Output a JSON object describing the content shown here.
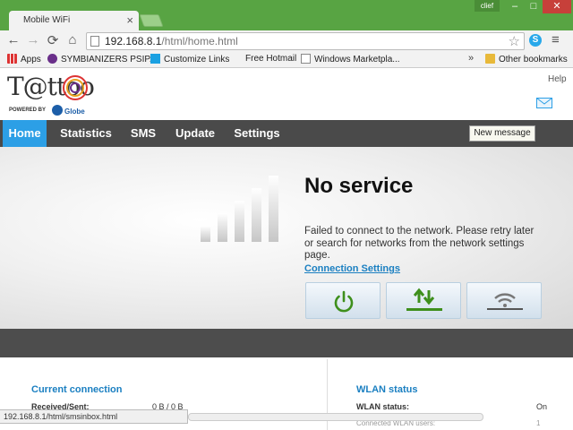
{
  "browser": {
    "tab_title": "Mobile WiFi",
    "tab_close": "×",
    "user_name": "clief",
    "window_controls": {
      "minimize": "–",
      "maximize": "□",
      "close": "✕"
    },
    "nav": {
      "back": "←",
      "forward": "→",
      "reload": "⟳",
      "home": "⌂"
    },
    "url_host": "192.168.8.1",
    "url_path": "/html/home.html",
    "star": "☆",
    "skype_label": "S",
    "menu": "≡",
    "bookmarks": [
      {
        "label": "Apps",
        "icon": "apps-icon"
      },
      {
        "label": "SYMBIANIZERS PSIP...",
        "icon": "symbianizers-icon"
      },
      {
        "label": "Customize Links",
        "icon": "windows-icon"
      },
      {
        "label": "Free Hotmail",
        "icon": "blank-icon"
      },
      {
        "label": "Windows Marketpla...",
        "icon": "document-icon"
      }
    ],
    "bookmarks_more": "»",
    "other_bookmarks": "Other bookmarks",
    "status_url": "192.168.8.1/html/smsinbox.html"
  },
  "header": {
    "logo_text": "T@ttoo",
    "logo_powered": "POWERED BY",
    "logo_brand": "Globe",
    "help": "Help",
    "tooltip": "New message"
  },
  "navbar": {
    "items": [
      "Home",
      "Statistics",
      "SMS",
      "Update",
      "Settings"
    ],
    "active": "Home"
  },
  "status": {
    "title": "No service",
    "description": "Failed to connect to the network. Please retry later or search for networks from the network settings page.",
    "link": "Connection Settings",
    "signal_bars_lit": 0,
    "signal_bars_total": 5
  },
  "actions": [
    {
      "name": "power-button",
      "icon": "power-icon"
    },
    {
      "name": "data-transfer-button",
      "icon": "up-down-arrows-icon"
    },
    {
      "name": "wifi-button",
      "icon": "wifi-icon"
    }
  ],
  "colors": {
    "accent": "#2c9fe6",
    "nav_bg": "#4a4a4a",
    "action_green": "#3e8f1c",
    "link": "#1a7fc1"
  },
  "current_connection": {
    "title": "Current connection",
    "received_sent_label": "Received/Sent:",
    "received_sent_value": "0 B / 0 B"
  },
  "wlan": {
    "title": "WLAN status",
    "status_label": "WLAN status:",
    "status_value": "On",
    "devices_label": "Connected WLAN users:",
    "devices_value": "1"
  }
}
